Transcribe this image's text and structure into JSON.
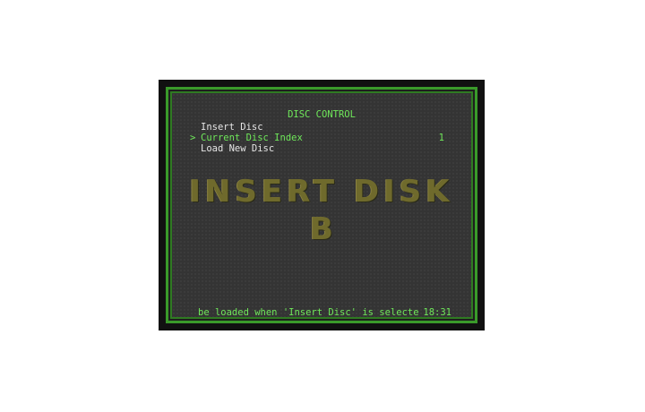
{
  "menu": {
    "title": "DISC CONTROL",
    "cursor": ">",
    "items": [
      {
        "label": "Insert Disc",
        "value": ""
      },
      {
        "label": "Current Disc Index",
        "value": "1"
      },
      {
        "label": "Load New Disc",
        "value": ""
      }
    ],
    "selected_index": 1
  },
  "background_art": {
    "line1": "INSERT DISK",
    "line2": "B"
  },
  "status_bar": {
    "text": "be loaded when 'Insert Disc' is selecte",
    "time": "18:31"
  },
  "colors": {
    "text_highlight": "#6fe85a",
    "text_normal": "#e6e6e6",
    "border": "#3a9a2a",
    "background": "#343434",
    "art": "#6f6a2c"
  }
}
